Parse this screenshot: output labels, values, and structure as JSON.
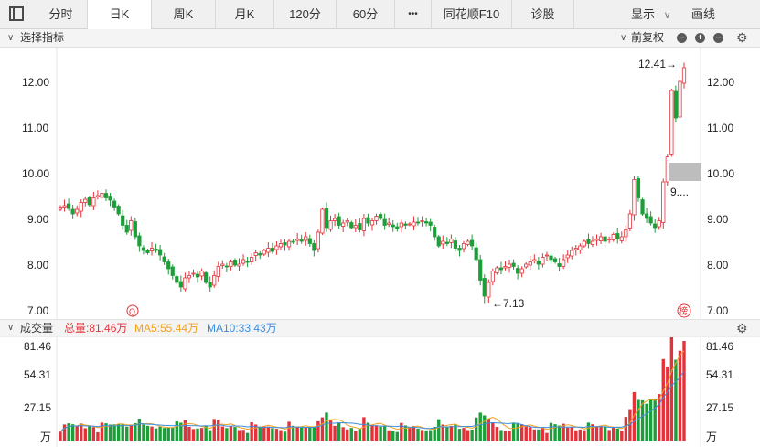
{
  "toolbar": {
    "tabs": [
      "分时",
      "日K",
      "周K",
      "月K",
      "120分",
      "60分",
      "•••",
      "同花顺F10",
      "诊股"
    ],
    "active_tab": "日K",
    "display_label": "显示",
    "draw_label": "画线"
  },
  "indicator_bar": {
    "select_label": "选择指标",
    "adjust_label": "前复权",
    "chevron_left": "∨",
    "chevron_right": "∨"
  },
  "price_chart": {
    "y_labels_left": [
      "12.00",
      "11.00",
      "10.00",
      "9.00",
      "8.00",
      "7.00"
    ],
    "y_labels_right": [
      "12.00",
      "11.00",
      "10.00",
      "9.00",
      "8.00",
      "7.00"
    ],
    "current_price_box": "9....",
    "high_annotation": "12.41→",
    "low_annotation": "←7.13",
    "marker_left": "Q",
    "marker_right": "榜"
  },
  "volume": {
    "title": "成交量",
    "total_label": "总量:81.46万",
    "ma5_label": "MA5:55.44万",
    "ma10_label": "MA10:33.43万",
    "y_labels_left": [
      "81.46",
      "54.31",
      "27.15",
      "万"
    ],
    "y_labels_right": [
      "81.46",
      "54.31",
      "27.15",
      "万"
    ]
  },
  "colors": {
    "up": "#e2323a",
    "down": "#1e9e3a",
    "ma5": "#f0a020",
    "ma10": "#3a8ee0",
    "total": "#e2323a"
  },
  "chart_data": {
    "type": "candlestick",
    "ylim": [
      7.0,
      12.6
    ],
    "closes": [
      9.25,
      9.28,
      9.22,
      9.1,
      9.2,
      9.35,
      9.42,
      9.3,
      9.45,
      9.5,
      9.55,
      9.45,
      9.4,
      9.25,
      9.1,
      8.85,
      8.7,
      8.95,
      8.6,
      8.4,
      8.3,
      8.25,
      8.35,
      8.3,
      8.2,
      8.05,
      7.9,
      7.75,
      7.6,
      7.5,
      7.7,
      7.75,
      7.8,
      7.72,
      7.85,
      7.6,
      7.5,
      7.75,
      7.95,
      8.0,
      7.95,
      8.05,
      7.98,
      8.0,
      8.1,
      8.05,
      8.15,
      8.25,
      8.2,
      8.3,
      8.35,
      8.28,
      8.4,
      8.45,
      8.42,
      8.5,
      8.48,
      8.55,
      8.5,
      8.6,
      8.45,
      8.3,
      8.7,
      9.2,
      8.8,
      8.95,
      9.0,
      8.85,
      8.9,
      8.95,
      8.8,
      8.85,
      8.75,
      9.0,
      8.9,
      8.95,
      9.05,
      9.0,
      8.85,
      8.9,
      8.82,
      8.78,
      8.9,
      8.85,
      8.88,
      8.92,
      8.9,
      8.95,
      8.9,
      8.85,
      8.6,
      8.4,
      8.5,
      8.45,
      8.55,
      8.35,
      8.3,
      8.45,
      8.5,
      8.4,
      8.1,
      7.65,
      7.3,
      7.6,
      7.85,
      7.92,
      7.88,
      7.95,
      8.0,
      7.95,
      7.8,
      7.9,
      8.0,
      8.05,
      8.1,
      8.0,
      8.15,
      8.2,
      8.1,
      8.05,
      7.95,
      8.1,
      8.2,
      8.3,
      8.35,
      8.4,
      8.5,
      8.45,
      8.5,
      8.55,
      8.6,
      8.5,
      8.55,
      8.65,
      8.55,
      8.6,
      8.75,
      9.1,
      9.85,
      9.45,
      9.1,
      9.0,
      8.9,
      8.8,
      8.95,
      9.8,
      10.35,
      11.8,
      11.2,
      12.0,
      12.3
    ],
    "low": 7.13,
    "high": 12.41,
    "volume_max": 81.46
  }
}
